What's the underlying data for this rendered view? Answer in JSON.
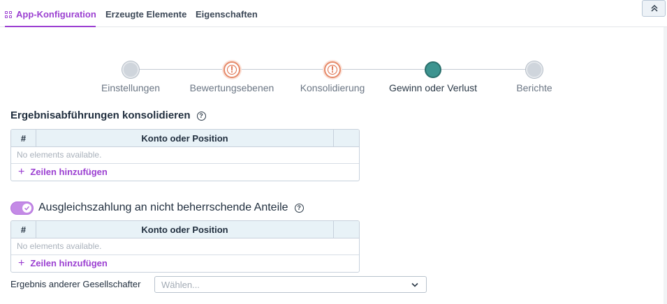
{
  "tabs": [
    {
      "label": "App-Konfiguration",
      "active": true,
      "icon": "grid-icon"
    },
    {
      "label": "Erzeugte Elemente",
      "active": false
    },
    {
      "label": "Eigenschaften",
      "active": false
    }
  ],
  "collapse_icon": "double-chevron-up-icon",
  "stepper": {
    "steps": [
      {
        "label": "Einstellungen",
        "status": "grey"
      },
      {
        "label": "Bewertungsebenen",
        "status": "warning"
      },
      {
        "label": "Konsolidierung",
        "status": "warning"
      },
      {
        "label": "Gewinn oder Verlust",
        "status": "current"
      },
      {
        "label": "Berichte",
        "status": "grey"
      }
    ],
    "warning_glyph": "!"
  },
  "section1": {
    "title": "Ergebnisabführungen konsolidieren",
    "table": {
      "headers": [
        "#",
        "Konto oder Position"
      ],
      "empty_text": "No elements available.",
      "add_label": "Zeilen hinzufügen",
      "add_glyph": "+"
    }
  },
  "section2": {
    "toggle_on": true,
    "title": "Ausgleichszahlung an nicht beherrschende Anteile",
    "table": {
      "headers": [
        "#",
        "Konto oder Position"
      ],
      "empty_text": "No elements available.",
      "add_label": "Zeilen hinzufügen",
      "add_glyph": "+"
    }
  },
  "field": {
    "label": "Ergebnis anderer Gesellschafter",
    "placeholder": "Wählen..."
  },
  "help_glyph": "?",
  "colors": {
    "accent": "#9b3fd1",
    "warning": "#de6a45",
    "current_step": "#3d9490",
    "table_header_bg": "#e8f2f7"
  }
}
